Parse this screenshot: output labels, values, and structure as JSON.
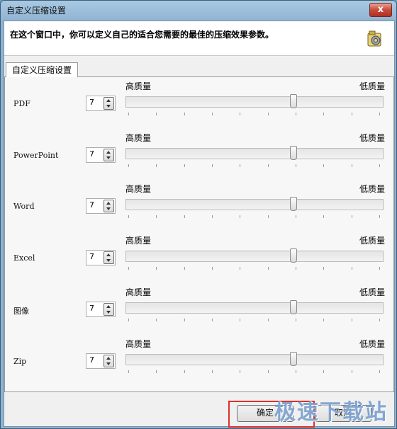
{
  "window": {
    "title": "自定义压缩设置",
    "close_glyph": "x"
  },
  "header": {
    "text": "在这个窗口中，你可以定义自己的适合您需要的最佳的压缩效果参数。",
    "icon": "settings-gear-icon"
  },
  "tab": {
    "label": "自定义压缩设置"
  },
  "quality_labels": {
    "high": "高质量",
    "low": "低质量"
  },
  "rows": [
    {
      "label": "PDF",
      "value": "7"
    },
    {
      "label": "PowerPoint",
      "value": "7"
    },
    {
      "label": "Word",
      "value": "7"
    },
    {
      "label": "Excel",
      "value": "7"
    },
    {
      "label": "图像",
      "value": "7"
    },
    {
      "label": "Zip",
      "value": "7"
    }
  ],
  "slider": {
    "min": 1,
    "max": 10
  },
  "buttons": {
    "ok": "确定",
    "cancel": "取消"
  },
  "watermark": "极速下载站",
  "colors": {
    "highlight": "#e0302a",
    "title_bg": "#8fb3d3"
  }
}
